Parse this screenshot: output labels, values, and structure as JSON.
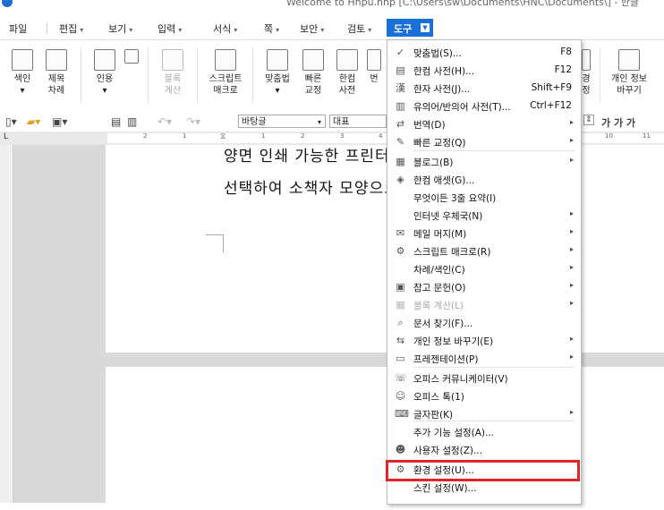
{
  "window": {
    "title": "Welcome to Hnpu.hnp [C:\\Users\\sw\\Documents\\HNC\\Documents\\] - 한글"
  },
  "menubar": {
    "items": [
      "파일",
      "편집",
      "보기",
      "입력",
      "서식",
      "쪽",
      "보안",
      "검토",
      "도구"
    ],
    "active": "도구"
  },
  "ribbon": {
    "buttons": [
      {
        "label": "색인",
        "sub": ""
      },
      {
        "label": "제목",
        "sub": "차례"
      },
      {
        "label": "인용",
        "sub": ""
      },
      {
        "label": "블록",
        "sub": "계산"
      },
      {
        "label": "스크립트",
        "sub": "매크로"
      },
      {
        "label": "맞춤법",
        "sub": ""
      },
      {
        "label": "빠른",
        "sub": "교정"
      },
      {
        "label": "한컴",
        "sub": "사전"
      },
      {
        "label": "번",
        "sub": ""
      },
      {
        "label": "경",
        "sub": "정"
      },
      {
        "label": "개인 정보",
        "sub": "바꾸기"
      }
    ]
  },
  "formatbar": {
    "style": "바탕글",
    "font": "대표",
    "bold_italic": "가 가 가"
  },
  "ruler": {
    "marks": [
      "2",
      "1",
      "1",
      "2",
      "3",
      "4",
      "10",
      "11"
    ]
  },
  "document": {
    "line1": "양면 인쇄 가능한 프린터 모양으로",
    "line2": "선택하여 소책자 모양으로"
  },
  "dropdown": {
    "items": [
      {
        "icon": "spell-check-icon",
        "glyph": "✓",
        "label": "맞춤법(S)...",
        "shortcut": "F8",
        "submenu": false,
        "disabled": false
      },
      {
        "icon": "dictionary-icon",
        "glyph": "▤",
        "label": "한컴 사전(H)...",
        "shortcut": "F12",
        "submenu": false,
        "disabled": false
      },
      {
        "icon": "hanja-dictionary-icon",
        "glyph": "漢",
        "label": "한자 사전(J)...",
        "shortcut": "Shift+F9",
        "submenu": false,
        "disabled": false
      },
      {
        "icon": "thesaurus-icon",
        "glyph": "▥",
        "label": "유의어/반의어 사전(T)...",
        "shortcut": "Ctrl+F12",
        "submenu": false,
        "disabled": false
      },
      {
        "icon": "translate-icon",
        "glyph": "⇄",
        "label": "번역(D)",
        "shortcut": "",
        "submenu": true,
        "disabled": false
      },
      {
        "icon": "quick-correct-icon",
        "glyph": "✎",
        "label": "빠른 교정(Q)",
        "shortcut": "",
        "submenu": true,
        "disabled": false
      },
      {
        "icon": "blog-icon",
        "glyph": "▦",
        "label": "블로그(B)",
        "shortcut": "",
        "submenu": true,
        "disabled": false
      },
      {
        "icon": "hancom-asset-icon",
        "glyph": "◈",
        "label": "한컴 애셋(G)...",
        "shortcut": "",
        "submenu": false,
        "disabled": false
      },
      {
        "icon": "",
        "glyph": "",
        "label": "무엇이든 3줄 요약(I)",
        "shortcut": "",
        "submenu": false,
        "disabled": false
      },
      {
        "icon": "",
        "glyph": "",
        "label": "인터넷 우체국(N)",
        "shortcut": "",
        "submenu": true,
        "disabled": false
      },
      {
        "icon": "mail-merge-icon",
        "glyph": "✉",
        "label": "메일 머지(M)",
        "shortcut": "",
        "submenu": true,
        "disabled": false
      },
      {
        "icon": "script-macro-icon",
        "glyph": "⚙",
        "label": "스크립트 매크로(R)",
        "shortcut": "",
        "submenu": true,
        "disabled": false
      },
      {
        "icon": "",
        "glyph": "",
        "label": "차례/색인(C)",
        "shortcut": "",
        "submenu": true,
        "disabled": false
      },
      {
        "icon": "bibliography-icon",
        "glyph": "▣",
        "label": "참고 문헌(O)",
        "shortcut": "",
        "submenu": true,
        "disabled": false
      },
      {
        "icon": "block-calc-icon",
        "glyph": "▦",
        "label": "블록 계산(L)",
        "shortcut": "",
        "submenu": true,
        "disabled": true
      },
      {
        "icon": "find-document-icon",
        "glyph": "⌕",
        "label": "문서 찾기(F)...",
        "shortcut": "",
        "submenu": false,
        "disabled": false
      },
      {
        "icon": "privacy-replace-icon",
        "glyph": "⇆",
        "label": "개인 정보 바꾸기(E)",
        "shortcut": "",
        "submenu": true,
        "disabled": false
      },
      {
        "icon": "presentation-icon",
        "glyph": "▭",
        "label": "프레젠테이션(P)",
        "shortcut": "",
        "submenu": true,
        "disabled": false
      },
      {
        "icon": "office-communicator-icon",
        "glyph": "☏",
        "label": "오피스 커뮤니케이터(V)",
        "shortcut": "",
        "submenu": false,
        "disabled": false
      },
      {
        "icon": "office-talk-icon",
        "glyph": "☺",
        "label": "오피스 톡(1)",
        "shortcut": "",
        "submenu": false,
        "disabled": false
      },
      {
        "icon": "keyboard-icon",
        "glyph": "⌨",
        "label": "글자판(K)",
        "shortcut": "",
        "submenu": true,
        "disabled": false
      },
      {
        "icon": "",
        "glyph": "",
        "label": "추가 기능 설정(A)...",
        "shortcut": "",
        "submenu": false,
        "disabled": false
      },
      {
        "icon": "user-settings-icon",
        "glyph": "☻",
        "label": "사용자 설정(Z)...",
        "shortcut": "",
        "submenu": false,
        "disabled": false
      },
      {
        "icon": "gear-icon",
        "glyph": "⚙",
        "label": "환경 설정(U)...",
        "shortcut": "",
        "submenu": false,
        "disabled": false
      },
      {
        "icon": "",
        "glyph": "",
        "label": "스킨 설정(W)...",
        "shortcut": "",
        "submenu": false,
        "disabled": false
      }
    ]
  },
  "colors": {
    "accent": "#1b6fd8",
    "highlight": "#e1232a"
  }
}
